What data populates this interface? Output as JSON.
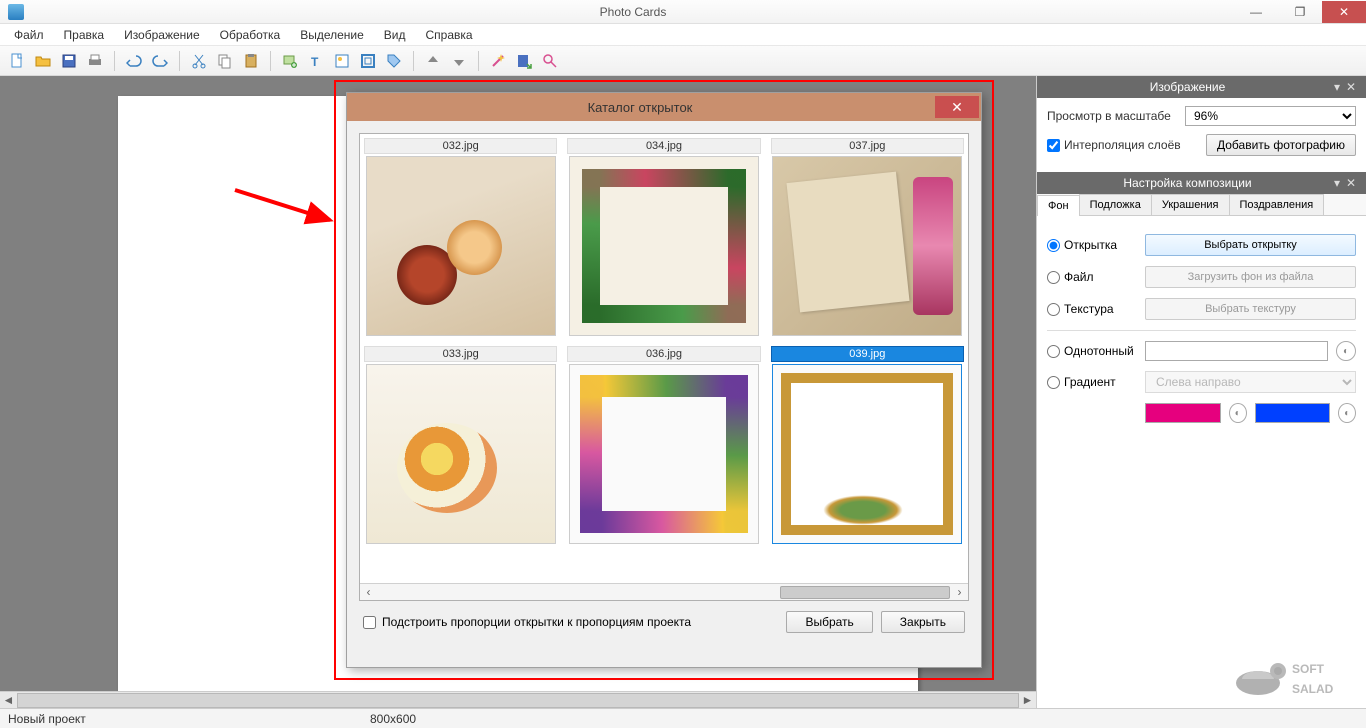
{
  "app": {
    "title": "Photo Cards"
  },
  "menu": [
    "Файл",
    "Правка",
    "Изображение",
    "Обработка",
    "Выделение",
    "Вид",
    "Справка"
  ],
  "status": {
    "project": "Новый проект",
    "dims": "800x600"
  },
  "dialog": {
    "title": "Каталог открыток",
    "items": [
      {
        "label": "032.jpg",
        "cls": "th032",
        "sel": false
      },
      {
        "label": "034.jpg",
        "cls": "th034",
        "sel": false
      },
      {
        "label": "037.jpg",
        "cls": "th037",
        "sel": false
      },
      {
        "label": "033.jpg",
        "cls": "th033",
        "sel": false
      },
      {
        "label": "036.jpg",
        "cls": "th036",
        "sel": false
      },
      {
        "label": "039.jpg",
        "cls": "th039",
        "sel": true
      }
    ],
    "fit_check": "Подстроить пропорции открытки к пропорциям проекта",
    "btn_select": "Выбрать",
    "btn_close": "Закрыть"
  },
  "panel_image": {
    "title": "Изображение",
    "scale_label": "Просмотр в масштабе",
    "scale_value": "96%",
    "interp_label": "Интерполяция слоёв",
    "add_photo": "Добавить фотографию"
  },
  "panel_comp": {
    "title": "Настройка композиции",
    "tabs": [
      "Фон",
      "Подложка",
      "Украшения",
      "Поздравления"
    ],
    "bg_options": {
      "card": "Открытка",
      "card_btn": "Выбрать открытку",
      "file": "Файл",
      "file_btn": "Загрузить фон из файла",
      "texture": "Текстура",
      "texture_btn": "Выбрать текстуру",
      "solid": "Однотонный",
      "gradient": "Градиент",
      "gradient_dir": "Слева направо"
    },
    "colors": {
      "solid": "#ffffff",
      "grad1": "#e6007e",
      "grad2": "#0040ff"
    }
  },
  "watermark": {
    "line1": "SOFT",
    "line2": "SALAD"
  }
}
